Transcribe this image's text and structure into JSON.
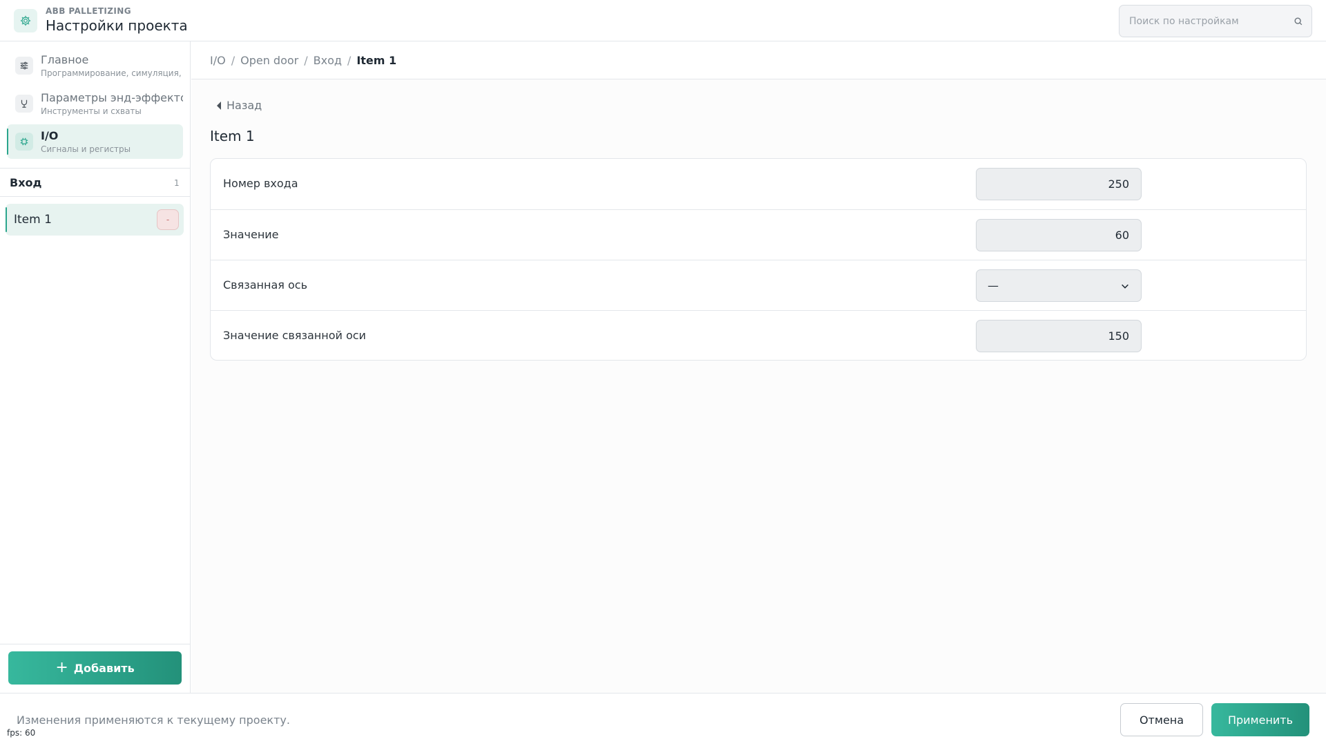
{
  "header": {
    "subtitle": "ABB PALLETIZING",
    "title": "Настройки проекта",
    "app_icon": "gear-icon",
    "search": {
      "placeholder": "Поиск по настройкам",
      "value": "",
      "icon": "search-icon"
    }
  },
  "sidebar": {
    "nav": [
      {
        "title": "Главное",
        "subtitle": "Программирование, симуляция, ,",
        "icon": "sliders-icon",
        "active": false
      },
      {
        "title": "Параметры энд-эффекторов",
        "subtitle": "Инструменты и схваты",
        "icon": "gripper-icon",
        "active": false
      },
      {
        "title": "I/O",
        "subtitle": "Сигналы и регистры",
        "icon": "chip-icon",
        "active": true
      }
    ],
    "section": {
      "title": "Вход",
      "count": "1"
    },
    "items": [
      {
        "label": "Item 1",
        "remove_label": "-"
      }
    ],
    "add_button": {
      "plus": "+",
      "label": "Добавить"
    }
  },
  "main": {
    "breadcrumb": [
      "I/O",
      "Open door",
      "Вход",
      "Item 1"
    ],
    "breadcrumb_sep": "/",
    "back_label": "Назад",
    "title": "Item 1",
    "fields": [
      {
        "label": "Номер входа",
        "value": "250",
        "type": "number"
      },
      {
        "label": "Значение",
        "value": "60",
        "type": "number"
      },
      {
        "label": "Связанная ось",
        "value": "—",
        "type": "select"
      },
      {
        "label": "Значение связанной оси",
        "value": "150",
        "type": "number"
      }
    ]
  },
  "footer": {
    "note": "Изменения применяются к текущему проекту.",
    "cancel_label": "Отмена",
    "apply_label": "Применить",
    "fps": "fps: 60"
  },
  "colors": {
    "accent": "#2aa58c",
    "accent_dark": "#23917a",
    "danger_bg": "#f6e3e3"
  }
}
